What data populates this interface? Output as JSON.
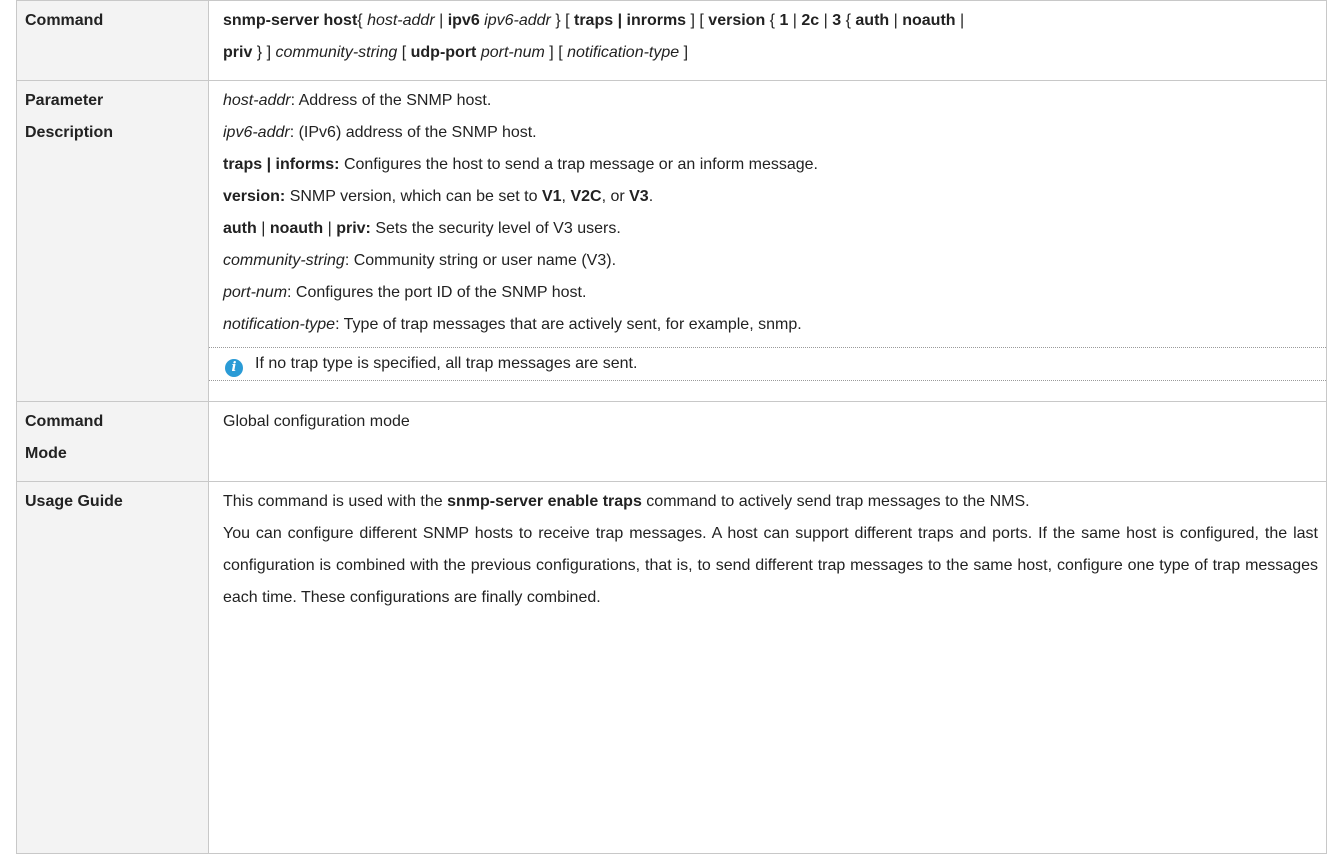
{
  "rows": {
    "command": {
      "label": "Command",
      "line1": [
        {
          "t": "snmp-server host",
          "s": "b"
        },
        {
          "t": "{ ",
          "s": ""
        },
        {
          "t": "host-addr",
          "s": "i"
        },
        {
          "t": " | ",
          "s": ""
        },
        {
          "t": "ipv6",
          "s": "b"
        },
        {
          "t": " ",
          "s": ""
        },
        {
          "t": "ipv6-addr",
          "s": "i"
        },
        {
          "t": " } [ ",
          "s": ""
        },
        {
          "t": "traps | inrorms",
          "s": "b"
        },
        {
          "t": " ] [ ",
          "s": ""
        },
        {
          "t": "version",
          "s": "b"
        },
        {
          "t": " { ",
          "s": ""
        },
        {
          "t": "1",
          "s": "b"
        },
        {
          "t": " | ",
          "s": ""
        },
        {
          "t": "2c",
          "s": "b"
        },
        {
          "t": " | ",
          "s": ""
        },
        {
          "t": "3",
          "s": "b"
        },
        {
          "t": " { ",
          "s": ""
        },
        {
          "t": "auth",
          "s": "b"
        },
        {
          "t": " | ",
          "s": ""
        },
        {
          "t": "noauth",
          "s": "b"
        },
        {
          "t": " |",
          "s": ""
        }
      ],
      "line2": [
        {
          "t": "priv",
          "s": "b"
        },
        {
          "t": " } ] ",
          "s": ""
        },
        {
          "t": "community-string",
          "s": "i"
        },
        {
          "t": " [ ",
          "s": ""
        },
        {
          "t": "udp-port",
          "s": "b"
        },
        {
          "t": " ",
          "s": ""
        },
        {
          "t": "port-num",
          "s": "i"
        },
        {
          "t": " ] [ ",
          "s": ""
        },
        {
          "t": "notification-type",
          "s": "i"
        },
        {
          "t": " ]",
          "s": ""
        }
      ]
    },
    "param": {
      "label_1": "Parameter",
      "label_2": "Description",
      "lines": [
        [
          {
            "t": "host-addr",
            "s": "i"
          },
          {
            "t": ": Address of the SNMP host.",
            "s": ""
          }
        ],
        [
          {
            "t": "ipv6-addr",
            "s": "i"
          },
          {
            "t": ": (IPv6) address of the SNMP host.",
            "s": ""
          }
        ],
        [
          {
            "t": "traps | informs:",
            "s": "b"
          },
          {
            "t": " Configures the host to send a trap message or an inform message.",
            "s": ""
          }
        ],
        [
          {
            "t": "version:",
            "s": "b"
          },
          {
            "t": " SNMP version, which can be set to ",
            "s": ""
          },
          {
            "t": "V1",
            "s": "b"
          },
          {
            "t": ", ",
            "s": ""
          },
          {
            "t": "V2C",
            "s": "b"
          },
          {
            "t": ", or ",
            "s": ""
          },
          {
            "t": "V3",
            "s": "b"
          },
          {
            "t": ".",
            "s": ""
          }
        ],
        [
          {
            "t": "auth",
            "s": "b"
          },
          {
            "t": " | ",
            "s": ""
          },
          {
            "t": "noauth",
            "s": "b"
          },
          {
            "t": " | ",
            "s": ""
          },
          {
            "t": "priv:",
            "s": "b"
          },
          {
            "t": " Sets the security level of V3 users.",
            "s": ""
          }
        ],
        [
          {
            "t": "community-string",
            "s": "i"
          },
          {
            "t": ": Community string or user name (V3).",
            "s": ""
          }
        ],
        [
          {
            "t": "port-num",
            "s": "i"
          },
          {
            "t": ": Configures the port ID of the SNMP host.",
            "s": ""
          }
        ],
        [
          {
            "t": "notification-type",
            "s": "i"
          },
          {
            "t": ": Type of trap messages that are actively sent, for example, snmp.",
            "s": ""
          }
        ]
      ],
      "note": "If no trap type is specified, all trap messages are sent.",
      "note_icon": "info-icon",
      "note_icon_color": "#2a9bd6"
    },
    "mode": {
      "label_1": "Command",
      "label_2": "Mode",
      "text": "Global configuration mode"
    },
    "usage": {
      "label": "Usage Guide",
      "para1": [
        {
          "t": "This command is used with the ",
          "s": ""
        },
        {
          "t": "snmp-server enable traps",
          "s": "b"
        },
        {
          "t": " command to actively send trap messages to the NMS.",
          "s": ""
        }
      ],
      "para2": "You can configure different SNMP hosts to receive trap messages. A host can support different traps and ports. If the same host is configured, the last configuration is combined with the previous configurations, that is, to send different trap messages to the same host, configure one type of trap messages each time. These configurations are finally combined."
    }
  }
}
